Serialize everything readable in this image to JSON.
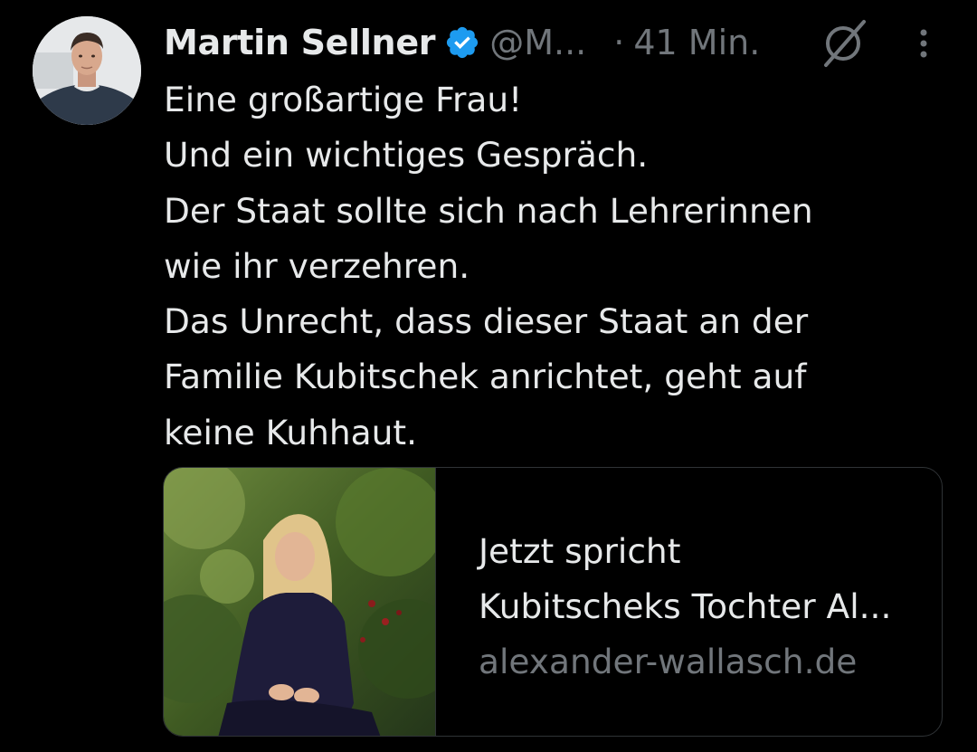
{
  "author": {
    "name": "Martin Sellner",
    "handle": "@M...",
    "separator": "·",
    "time": "41 Min."
  },
  "tweet": {
    "lines": [
      "Eine großartige Frau!",
      "Und ein wichtiges Gespräch.",
      "Der Staat sollte sich nach Lehrerinnen",
      "wie ihr verzehren.",
      "Das Unrecht, dass dieser Staat an der",
      "Familie Kubitschek anrichtet, geht auf",
      "keine Kuhhaut."
    ]
  },
  "card": {
    "title_line_1": "Jetzt spricht",
    "title_line_2": "Kubitscheks Tochter Al...",
    "domain": "alexander-wallasch.de"
  },
  "icons": {
    "verified": "verified-badge-icon",
    "grok": "grok-icon",
    "more": "more-options-icon"
  },
  "colors": {
    "background": "#000000",
    "text_primary": "#e7e9ea",
    "text_secondary": "#71767b",
    "verified_blue": "#1d9bf0",
    "border": "#2f3336"
  }
}
